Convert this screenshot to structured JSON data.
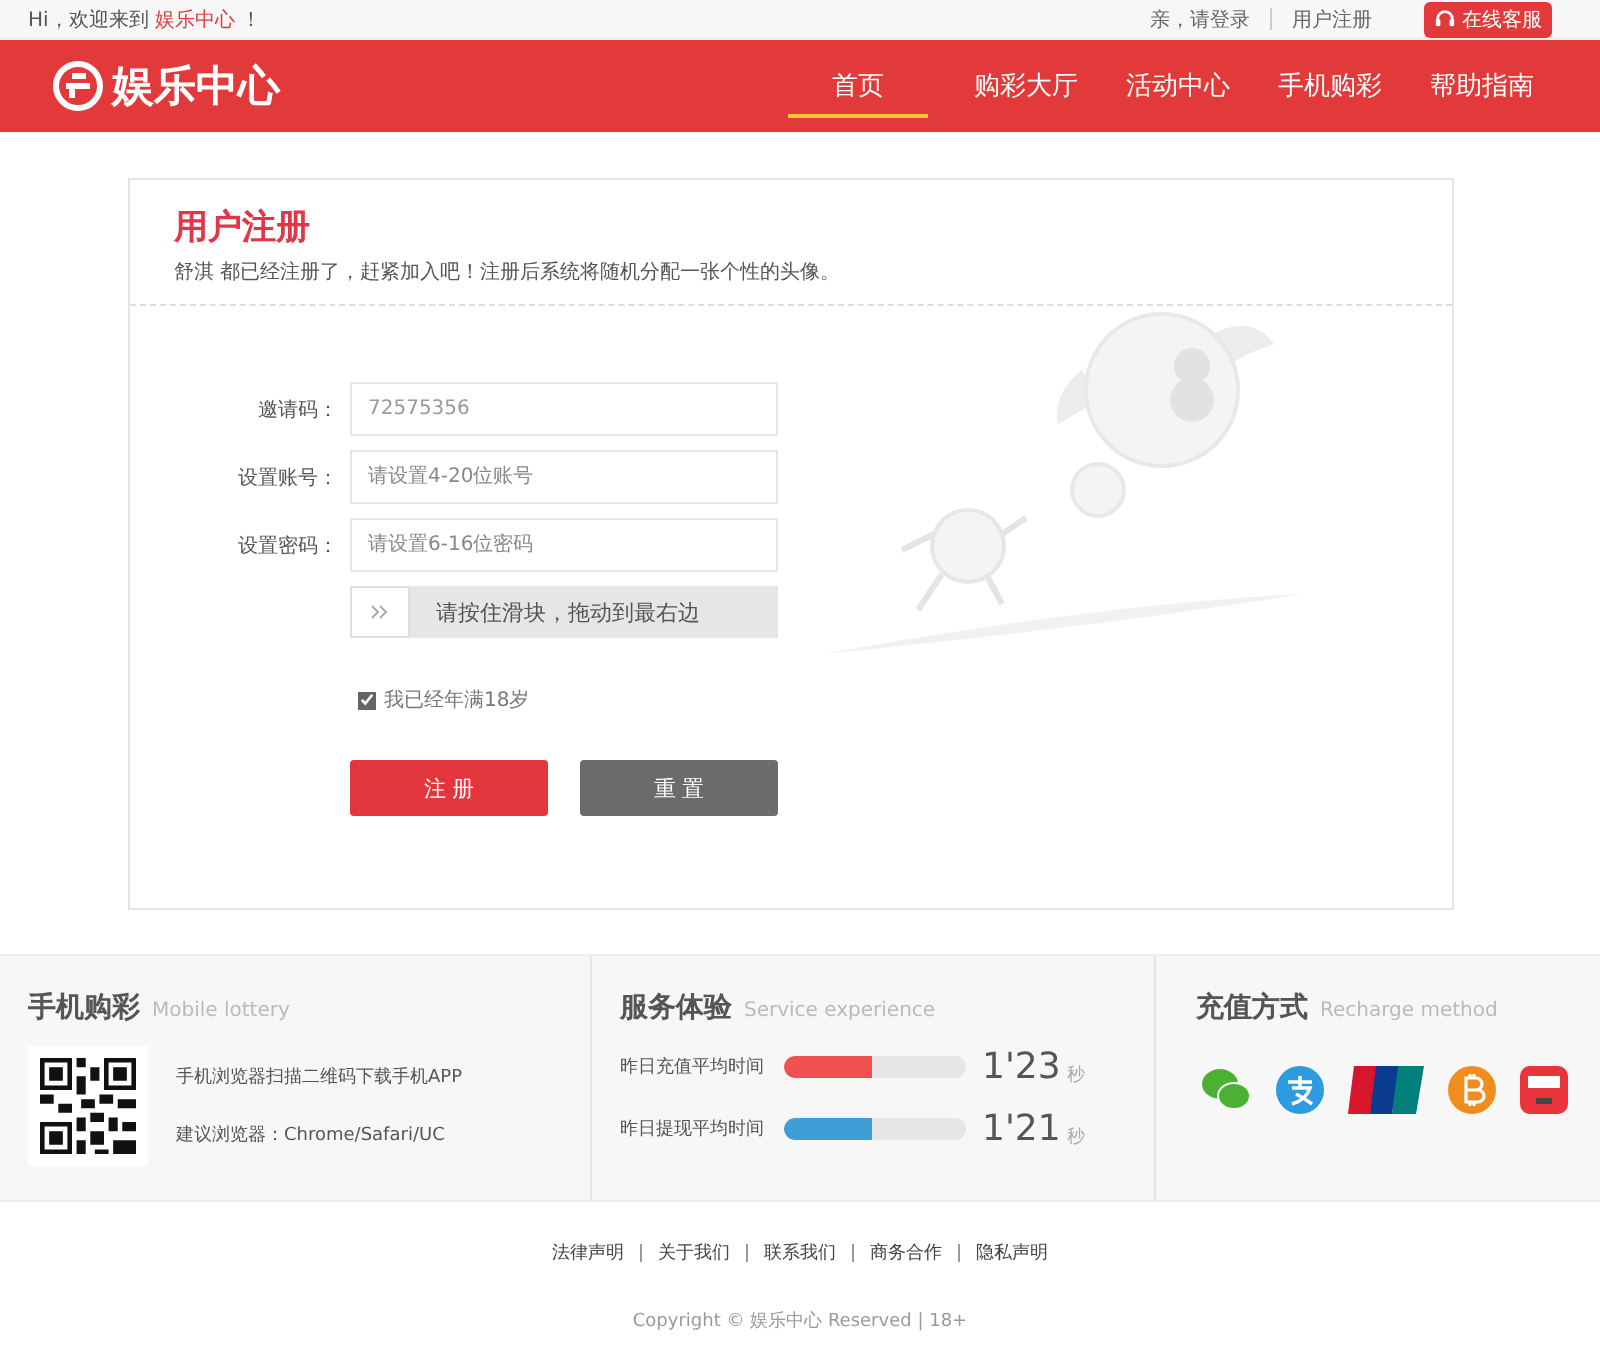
{
  "topbar": {
    "welcome": {
      "prefix": "Hi，欢迎来到",
      "site": "娱乐中心",
      "suffix": "！"
    },
    "links": [
      "亲，请登录",
      "用户注册"
    ],
    "service_button": "在线客服"
  },
  "header": {
    "logo": "娱乐中心",
    "nav": [
      {
        "label": "首页",
        "selected": true
      },
      {
        "label": "购彩大厅",
        "selected": false
      },
      {
        "label": "活动中心",
        "selected": false
      },
      {
        "label": "手机购彩",
        "selected": false
      },
      {
        "label": "帮助指南",
        "selected": false
      }
    ]
  },
  "register": {
    "title": "用户注册",
    "subtitle": "舒淇 都已经注册了，赶紧加入吧！注册后系统将随机分配一张个性的头像。",
    "fields": [
      {
        "label": "邀请码：",
        "value": "72575356"
      },
      {
        "label": "设置账号：",
        "placeholder": "请设置4-20位账号"
      },
      {
        "label": "设置密码：",
        "placeholder": "请设置6-16位密码"
      }
    ],
    "slider": {
      "hint": "请按住滑块，拖动到最右边"
    },
    "age_check": {
      "label": "我已经年满18岁",
      "checked": true
    },
    "buttons": [
      {
        "label": "注 册",
        "kind": "primary"
      },
      {
        "label": "重 置",
        "kind": "secondary"
      }
    ]
  },
  "footer": {
    "mobile": {
      "title": "手机购彩",
      "subtitle": "Mobile lottery",
      "lines": [
        "手机浏览器扫描二维码下载手机APP",
        "建议浏览器：Chrome/Safari/UC"
      ]
    },
    "service": {
      "title": "服务体验",
      "subtitle": "Service experience",
      "stats": [
        {
          "label": "昨日充值平均时间",
          "level": 0.48,
          "color": "#f05050",
          "value": "1'23",
          "unit": "秒"
        },
        {
          "label": "昨日提现平均时间",
          "level": 0.48,
          "color": "#3d9fd6",
          "value": "1'21",
          "unit": "秒"
        }
      ]
    },
    "recharge": {
      "title": "充值方式",
      "subtitle": "Recharge method",
      "methods": [
        {
          "kind": "wechat"
        },
        {
          "kind": "alipay"
        },
        {
          "kind": "unionpay"
        },
        {
          "kind": "bitcoin"
        },
        {
          "kind": "wallet"
        }
      ]
    },
    "links": [
      "法律声明",
      "关于我们",
      "联系我们",
      "商务合作",
      "隐私声明"
    ],
    "copyright": "Copyright © 娱乐中心 Reserved | 18+"
  }
}
